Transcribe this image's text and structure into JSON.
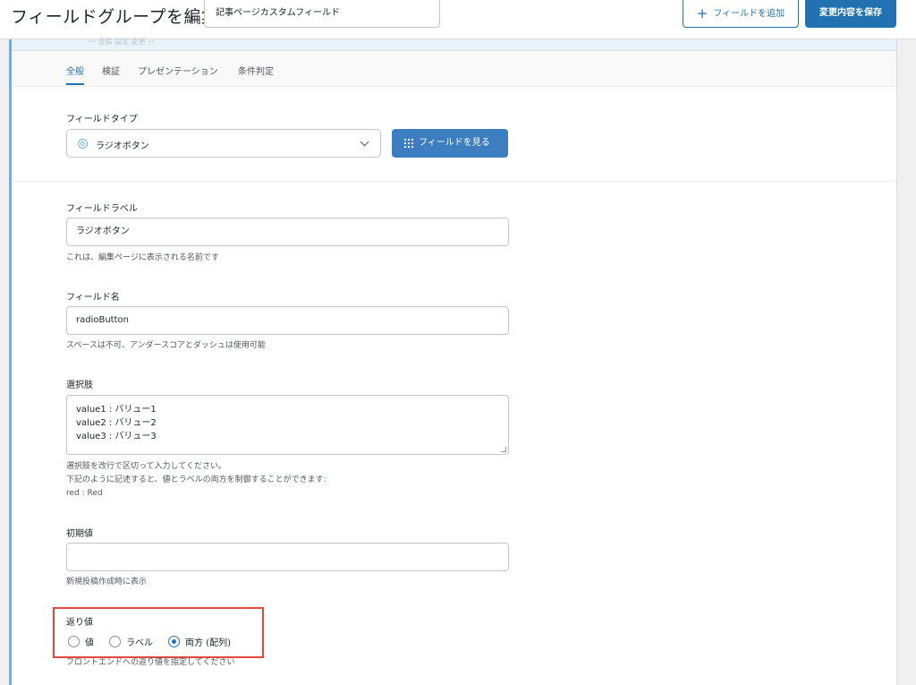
{
  "header": {
    "title": "フィールドグループを編集",
    "group_name_value": "記事ページカスタムフィールド",
    "add_field_label": "フィールドを追加",
    "save_label": "変更内容を保存"
  },
  "panel": {
    "faint_strip_text": "ｰｰ 全般 設定 変更 ｰｰ",
    "tabs": [
      {
        "label": "全般",
        "active": true
      },
      {
        "label": "検証",
        "active": false
      },
      {
        "label": "プレゼンテーション",
        "active": false
      },
      {
        "label": "条件判定",
        "active": false
      }
    ],
    "field_type": {
      "label": "フィールドタイプ",
      "value": "ラジオボタン",
      "browse_label": "フィールドを見る"
    },
    "field_label": {
      "label": "フィールドラベル",
      "value": "ラジオボタン",
      "help": "これは、編集ページに表示される名前です"
    },
    "field_name": {
      "label": "フィールド名",
      "value": "radioButton",
      "help": "スペースは不可、アンダースコアとダッシュは使用可能"
    },
    "choices": {
      "label": "選択肢",
      "value": "value1 : バリュー1\nvalue2 : バリュー2\nvalue3 : バリュー3",
      "help_line1": "選択肢を改行で区切って入力してください。",
      "help_line2": "下記のように記述すると、値とラベルの両方を制御することができます:",
      "help_line3": "red : Red"
    },
    "default_value": {
      "label": "初期値",
      "value": "",
      "help": "新規投稿作成時に表示"
    },
    "return_value": {
      "label": "返り値",
      "options": [
        {
          "label": "値",
          "checked": false
        },
        {
          "label": "ラベル",
          "checked": false
        },
        {
          "label": "両方 (配列)",
          "checked": true
        }
      ],
      "help": "フロントエンドへの返り値を指定してください"
    }
  },
  "colors": {
    "accent": "#2271b1",
    "highlight": "#e2483d"
  }
}
